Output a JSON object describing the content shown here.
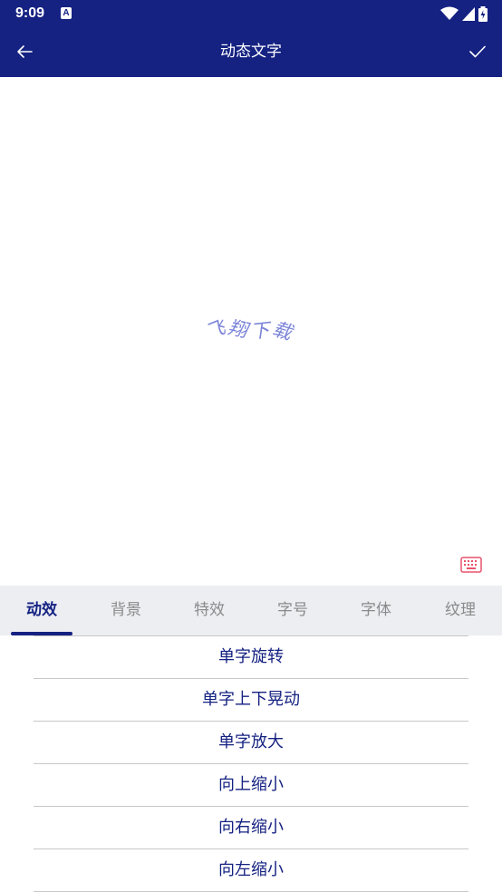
{
  "status_bar": {
    "time": "9:09",
    "notification_icon": "a-square-icon"
  },
  "app_bar": {
    "title": "动态文字",
    "back_icon": "back-arrow-icon",
    "confirm_icon": "check-icon"
  },
  "preview": {
    "text": "飞翔下载",
    "text_color": "#7b84d8",
    "tool_icon": "keyboard-icon"
  },
  "tabs": [
    {
      "label": "动效",
      "active": true
    },
    {
      "label": "背景",
      "active": false
    },
    {
      "label": "特效",
      "active": false
    },
    {
      "label": "字号",
      "active": false
    },
    {
      "label": "字体",
      "active": false
    },
    {
      "label": "纹理",
      "active": false
    }
  ],
  "effects": [
    "单字旋转",
    "单字上下晃动",
    "单字放大",
    "向上缩小",
    "向右缩小",
    "向左缩小"
  ],
  "colors": {
    "primary": "#152282",
    "tab_bg": "#eceef2",
    "inactive_tab": "#8a8a8a",
    "accent_icon": "#e8536c"
  }
}
